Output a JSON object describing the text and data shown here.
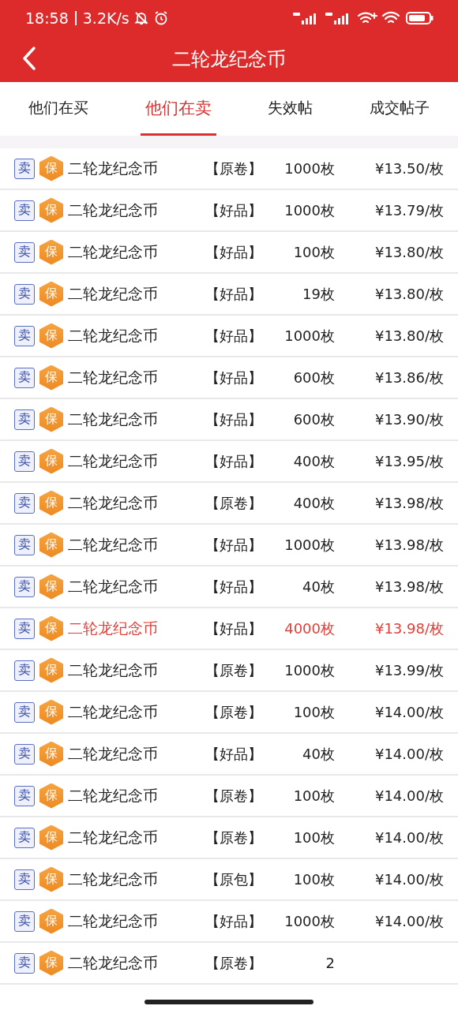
{
  "status_bar": {
    "time": "18:58",
    "speed": "3.2K/s"
  },
  "header": {
    "title": "二轮龙纪念币"
  },
  "tabs": [
    {
      "label": "他们在买",
      "selected": false
    },
    {
      "label": "他们在卖",
      "selected": true
    },
    {
      "label": "失效帖",
      "selected": false
    },
    {
      "label": "成交帖子",
      "selected": false
    }
  ],
  "listings": [
    {
      "type_badge": "卖",
      "guarantee_badge": "保",
      "name": "二轮龙纪念币",
      "grade": "【原卷】",
      "quantity": "1000枚",
      "price": "¥13.50/枚",
      "highlighted": false
    },
    {
      "type_badge": "卖",
      "guarantee_badge": "保",
      "name": "二轮龙纪念币",
      "grade": "【好品】",
      "quantity": "1000枚",
      "price": "¥13.79/枚",
      "highlighted": false
    },
    {
      "type_badge": "卖",
      "guarantee_badge": "保",
      "name": "二轮龙纪念币",
      "grade": "【好品】",
      "quantity": "100枚",
      "price": "¥13.80/枚",
      "highlighted": false
    },
    {
      "type_badge": "卖",
      "guarantee_badge": "保",
      "name": "二轮龙纪念币",
      "grade": "【好品】",
      "quantity": "19枚",
      "price": "¥13.80/枚",
      "highlighted": false
    },
    {
      "type_badge": "卖",
      "guarantee_badge": "保",
      "name": "二轮龙纪念币",
      "grade": "【好品】",
      "quantity": "1000枚",
      "price": "¥13.80/枚",
      "highlighted": false
    },
    {
      "type_badge": "卖",
      "guarantee_badge": "保",
      "name": "二轮龙纪念币",
      "grade": "【好品】",
      "quantity": "600枚",
      "price": "¥13.86/枚",
      "highlighted": false
    },
    {
      "type_badge": "卖",
      "guarantee_badge": "保",
      "name": "二轮龙纪念币",
      "grade": "【好品】",
      "quantity": "600枚",
      "price": "¥13.90/枚",
      "highlighted": false
    },
    {
      "type_badge": "卖",
      "guarantee_badge": "保",
      "name": "二轮龙纪念币",
      "grade": "【好品】",
      "quantity": "400枚",
      "price": "¥13.95/枚",
      "highlighted": false
    },
    {
      "type_badge": "卖",
      "guarantee_badge": "保",
      "name": "二轮龙纪念币",
      "grade": "【原卷】",
      "quantity": "400枚",
      "price": "¥13.98/枚",
      "highlighted": false
    },
    {
      "type_badge": "卖",
      "guarantee_badge": "保",
      "name": "二轮龙纪念币",
      "grade": "【好品】",
      "quantity": "1000枚",
      "price": "¥13.98/枚",
      "highlighted": false
    },
    {
      "type_badge": "卖",
      "guarantee_badge": "保",
      "name": "二轮龙纪念币",
      "grade": "【好品】",
      "quantity": "40枚",
      "price": "¥13.98/枚",
      "highlighted": false
    },
    {
      "type_badge": "卖",
      "guarantee_badge": "保",
      "name": "二轮龙纪念币",
      "grade": "【好品】",
      "quantity": "4000枚",
      "price": "¥13.98/枚",
      "highlighted": true
    },
    {
      "type_badge": "卖",
      "guarantee_badge": "保",
      "name": "二轮龙纪念币",
      "grade": "【原卷】",
      "quantity": "1000枚",
      "price": "¥13.99/枚",
      "highlighted": false
    },
    {
      "type_badge": "卖",
      "guarantee_badge": "保",
      "name": "二轮龙纪念币",
      "grade": "【原卷】",
      "quantity": "100枚",
      "price": "¥14.00/枚",
      "highlighted": false
    },
    {
      "type_badge": "卖",
      "guarantee_badge": "保",
      "name": "二轮龙纪念币",
      "grade": "【好品】",
      "quantity": "40枚",
      "price": "¥14.00/枚",
      "highlighted": false
    },
    {
      "type_badge": "卖",
      "guarantee_badge": "保",
      "name": "二轮龙纪念币",
      "grade": "【原卷】",
      "quantity": "100枚",
      "price": "¥14.00/枚",
      "highlighted": false
    },
    {
      "type_badge": "卖",
      "guarantee_badge": "保",
      "name": "二轮龙纪念币",
      "grade": "【原卷】",
      "quantity": "100枚",
      "price": "¥14.00/枚",
      "highlighted": false
    },
    {
      "type_badge": "卖",
      "guarantee_badge": "保",
      "name": "二轮龙纪念币",
      "grade": "【原包】",
      "quantity": "100枚",
      "price": "¥14.00/枚",
      "highlighted": false
    },
    {
      "type_badge": "卖",
      "guarantee_badge": "保",
      "name": "二轮龙纪念币",
      "grade": "【好品】",
      "quantity": "1000枚",
      "price": "¥14.00/枚",
      "highlighted": false
    },
    {
      "type_badge": "卖",
      "guarantee_badge": "保",
      "name": "二轮龙纪念币",
      "grade": "【原卷】",
      "quantity": "2",
      "highlighted": false
    }
  ]
}
